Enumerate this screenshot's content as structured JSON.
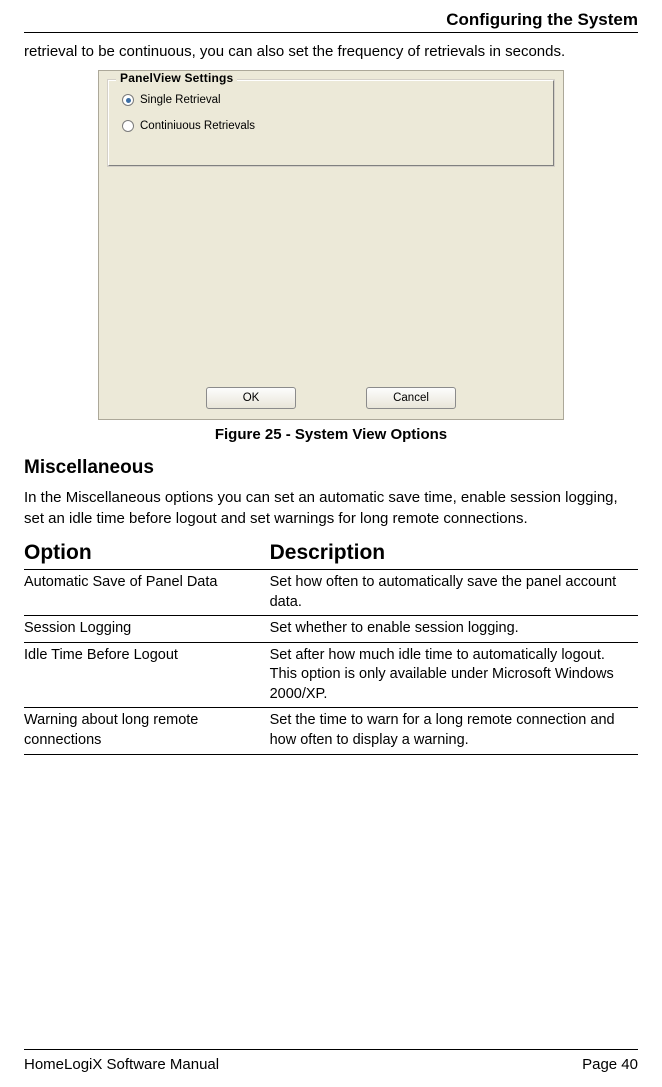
{
  "header": {
    "title": "Configuring the System"
  },
  "intro": "retrieval to be continuous, you can also set the frequency of retrievals in seconds.",
  "dialog": {
    "group_title": "PanelView Settings",
    "radio1": "Single Retrieval",
    "radio2": "Continiuous Retrievals",
    "ok": "OK",
    "cancel": "Cancel"
  },
  "figure_caption": "Figure 25 - System View Options",
  "misc": {
    "heading": "Miscellaneous",
    "intro": "In the Miscellaneous options you can set an automatic save time, enable session logging, set an idle time before logout and set warnings for long remote connections."
  },
  "table": {
    "headers": {
      "option": "Option",
      "description": "Description"
    },
    "rows": [
      {
        "option": "Automatic Save of Panel Data",
        "description": "Set how often to automatically save the panel account data."
      },
      {
        "option": "Session Logging",
        "description": "Set whether to enable session logging."
      },
      {
        "option": "Idle Time Before Logout",
        "description": "Set after how much idle time to automatically logout. This option is only available under Microsoft Windows 2000/XP."
      },
      {
        "option": "Warning about long remote connections",
        "description": "Set the time to warn for a long remote connection and how often to display a warning."
      }
    ]
  },
  "footer": {
    "left": "HomeLogiX Software Manual",
    "right": "Page 40"
  }
}
